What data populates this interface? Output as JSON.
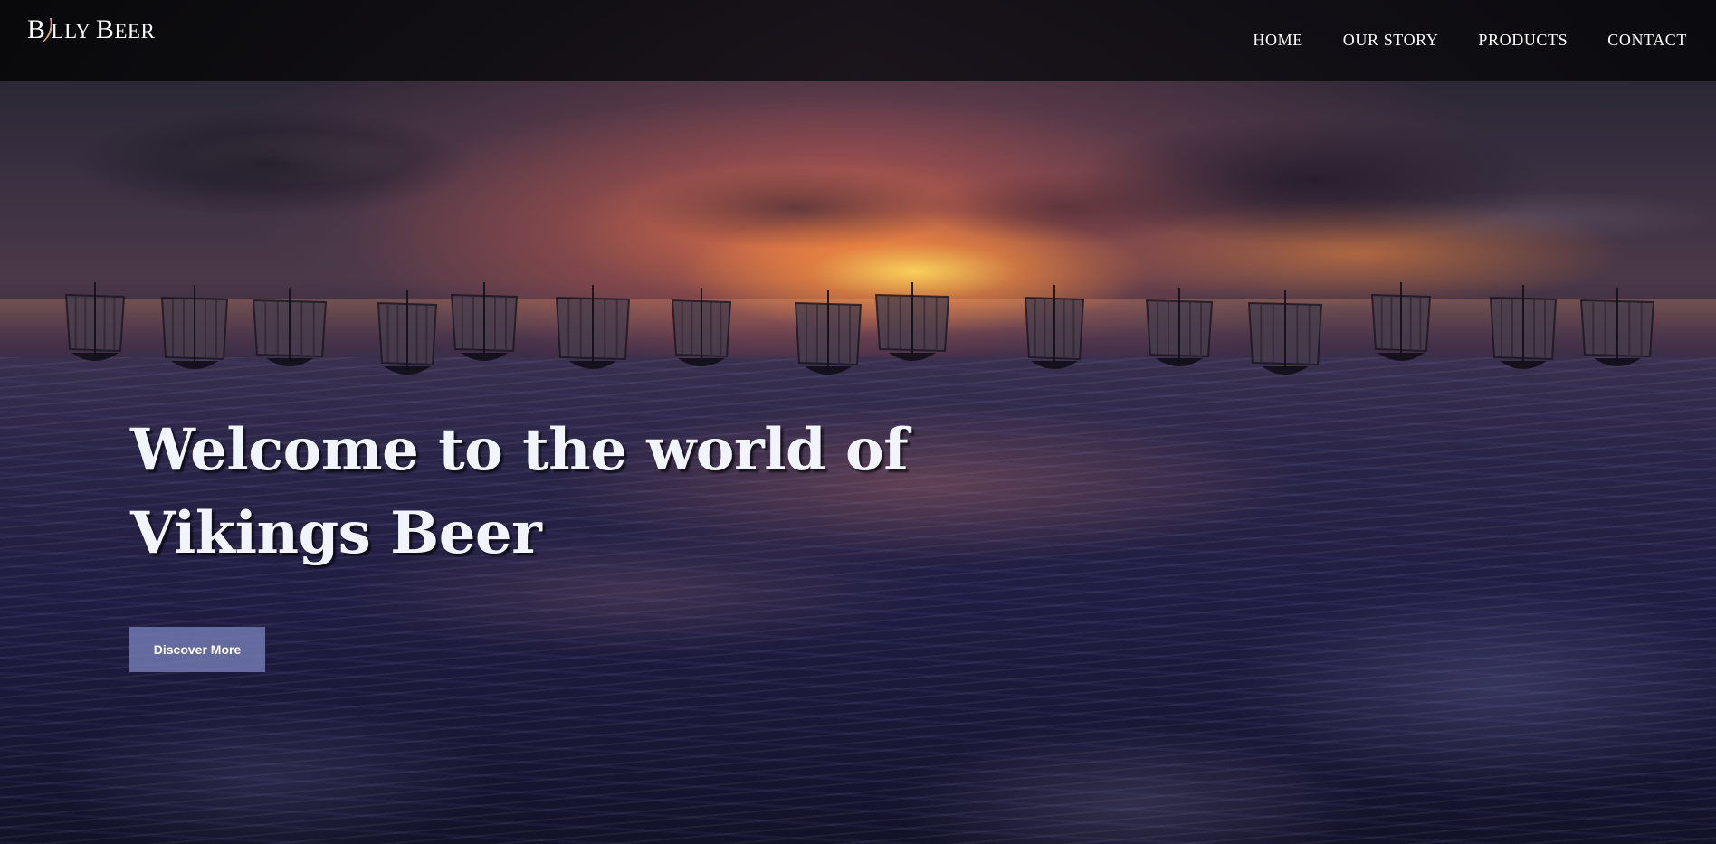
{
  "brand": {
    "logo_first": "B",
    "logo_rest": "LLY ",
    "logo_word2_first": "B",
    "logo_word2_rest": "EER",
    "logo_alt": "Billy Beer"
  },
  "nav": {
    "items": [
      {
        "label": "HOME"
      },
      {
        "label": "OUR STORY"
      },
      {
        "label": "PRODUCTS"
      },
      {
        "label": "CONTACT"
      }
    ]
  },
  "hero": {
    "headline_line1": "Welcome to the world of",
    "headline_line2": "Vikings Beer",
    "cta_label": "Discover More",
    "scene_icon": "viking-ships-sunset-sea"
  },
  "colors": {
    "cta_bg": "#7880ba",
    "headline_text": "#f2f4fb",
    "nav_text": "#ffffff"
  }
}
